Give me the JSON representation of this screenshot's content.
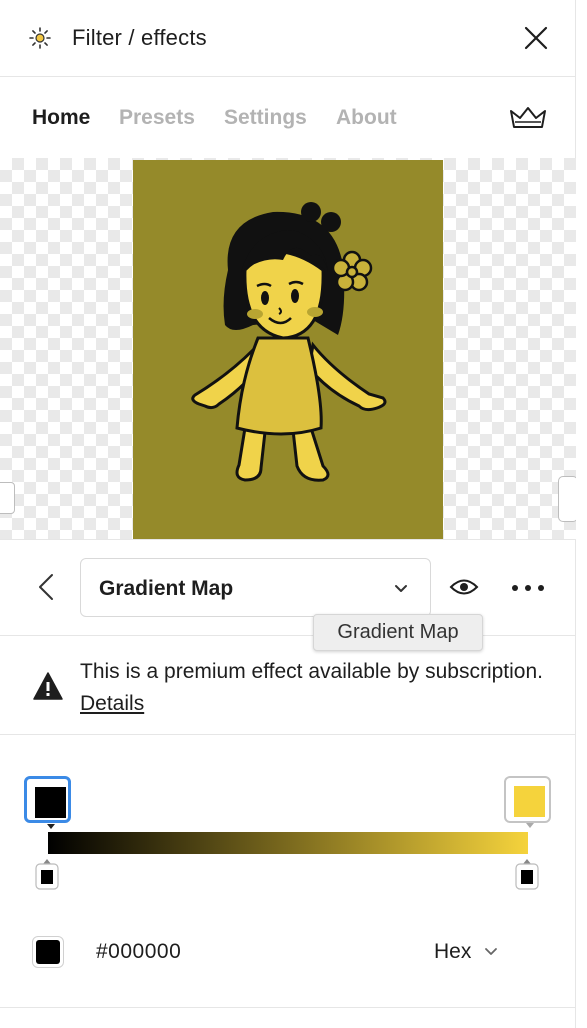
{
  "window": {
    "title": "Filter / effects",
    "icon": "sun-sparkle-icon",
    "close_icon": "close-icon"
  },
  "tabs": [
    {
      "label": "Home",
      "active": true
    },
    {
      "label": "Presets",
      "active": false
    },
    {
      "label": "Settings",
      "active": false
    },
    {
      "label": "About",
      "active": false
    }
  ],
  "premium_icon": "crown-icon",
  "preview": {
    "background": "#958a2a",
    "character_color": "#f0d34a"
  },
  "effect": {
    "selected": "Gradient Map",
    "tooltip": "Gradient Map",
    "back_icon": "chevron-left-icon",
    "visibility_icon": "eye-icon",
    "more_icon": "more-horizontal-icon"
  },
  "notice": {
    "icon": "warning-icon",
    "text": "This is a premium effect available by subscription.",
    "link": "Details"
  },
  "gradient": {
    "start_color": "#000000",
    "end_color": "#f5d33c",
    "selected_stop": "start"
  },
  "color_input": {
    "value": "#000000",
    "format": "Hex",
    "swatch_color": "#000000"
  },
  "colors": {
    "accent_blue": "#3b8ae6",
    "text_primary": "#1e1e1e",
    "text_muted": "#b3b3b3"
  }
}
